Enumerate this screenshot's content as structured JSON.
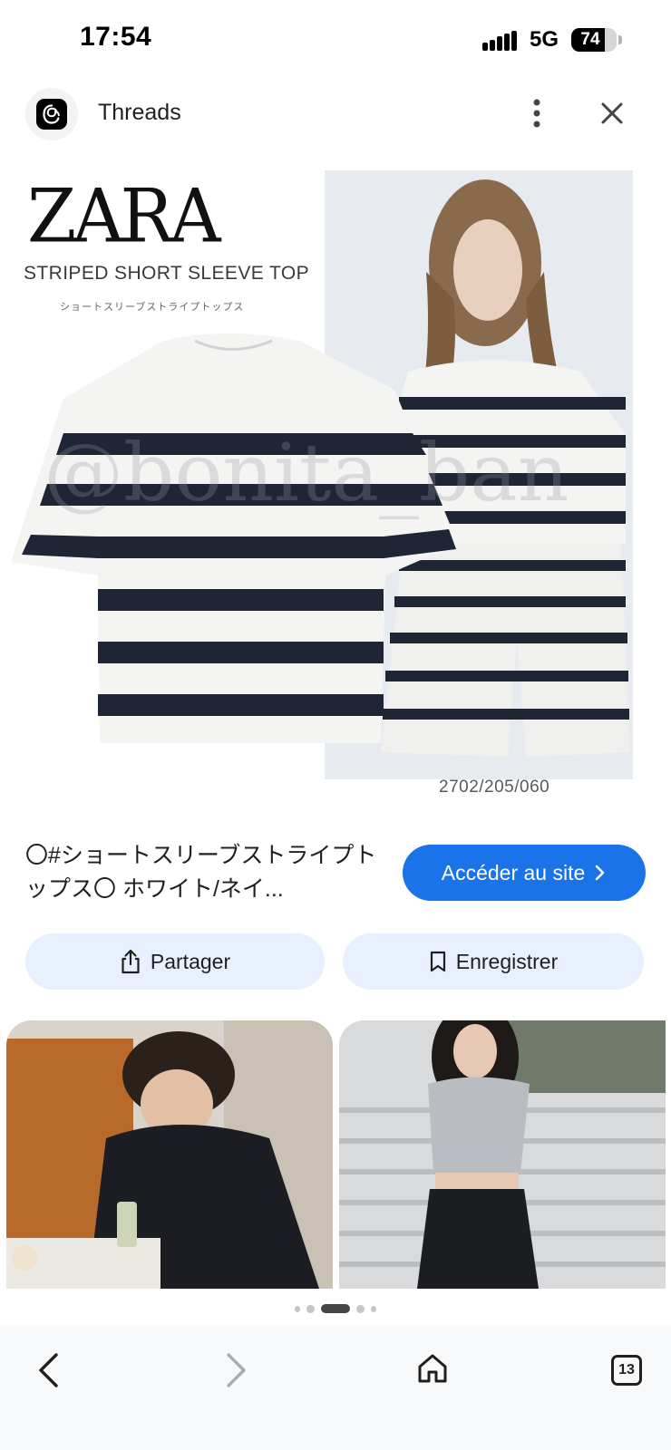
{
  "status_bar": {
    "time": "17:54",
    "network": "5G",
    "battery_percent": "74",
    "battery_level": 0.74
  },
  "header": {
    "app_name": "Threads",
    "app_icon": "threads-logo-icon",
    "menu_icon": "more-vert-icon",
    "close_icon": "close-icon"
  },
  "main_image": {
    "brand": "ZARA",
    "title": "STRIPED SHORT SLEEVE TOP",
    "subtitle": "ショートスリーブストライプトップス",
    "watermark": "@bonita_ban",
    "code": "2702/205/060",
    "stripe_color": "#1f2535",
    "base_color": "#f2f2f0"
  },
  "result": {
    "caption": "〇#ショートスリーブストライプトップス〇 ホワイト/ネイ...",
    "visit_label": "Accéder au site",
    "share_label": "Partager",
    "save_label": "Enregistrer"
  },
  "colors": {
    "accent": "#1a73e8",
    "tonal_button": "#e8f0fe"
  },
  "page_indicator": {
    "count": 5,
    "active_index": 2
  },
  "bottom_nav": {
    "back_icon": "back-arrow-icon",
    "forward_icon": "forward-arrow-icon",
    "home_icon": "home-icon",
    "tab_count": "13"
  }
}
